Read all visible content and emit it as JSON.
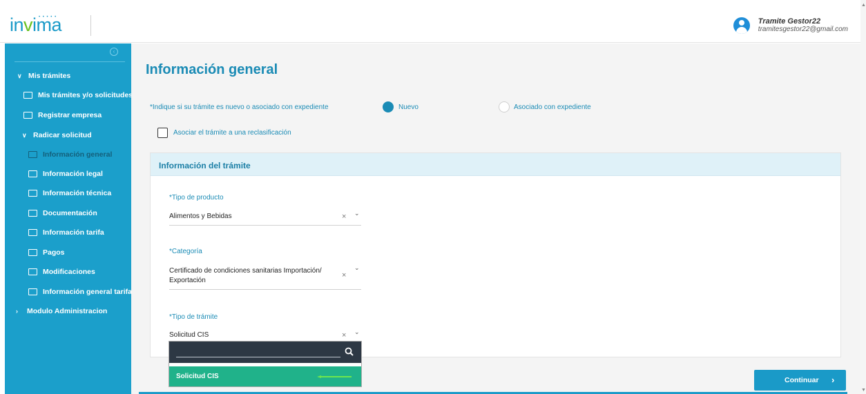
{
  "header": {
    "logo_text": "invima",
    "user_name": "Tramite Gestor22",
    "user_email": "tramitesgestor22@gmail.com"
  },
  "sidebar": {
    "collapse_icon": "collapse-circle-icon",
    "items": [
      {
        "label": "Mis trámites",
        "icon": "chevron-down-icon"
      },
      {
        "label": "Mis trámites y/o solicitudes",
        "icon": "folder-icon"
      },
      {
        "label": "Registrar empresa",
        "icon": "folder-icon"
      },
      {
        "label": "Radicar solicitud",
        "icon": "chevron-down-icon"
      },
      {
        "label": "Información general",
        "icon": "folder-icon",
        "active": true
      },
      {
        "label": "Información legal",
        "icon": "folder-icon"
      },
      {
        "label": "Información técnica",
        "icon": "folder-icon"
      },
      {
        "label": "Documentación",
        "icon": "folder-icon"
      },
      {
        "label": "Información tarifa",
        "icon": "folder-icon"
      },
      {
        "label": "Pagos",
        "icon": "folder-icon"
      },
      {
        "label": "Modificaciones",
        "icon": "folder-icon"
      },
      {
        "label": "Información general tarifa",
        "icon": "folder-icon"
      },
      {
        "label": "Modulo Administracion",
        "icon": "chevron-right-icon"
      }
    ]
  },
  "main": {
    "title": "Información general",
    "question": "*Indique si su trámite es nuevo o asociado con expediente",
    "radio_new": "Nuevo",
    "radio_associated": "Asociado con expediente",
    "radio_selected": "Nuevo",
    "checkbox_label": "Asociar el trámite a una reclasificación",
    "checkbox_checked": false
  },
  "card": {
    "title": "Información del trámite",
    "product_type_label": "*Tipo de producto",
    "product_type_value": "Alimentos y Bebidas",
    "category_label": "*Categoría",
    "category_value_line1": "Certificado de condiciones sanitarias Importación/",
    "category_value_line2": "Exportación",
    "procedure_type_label": "*Tipo de trámite",
    "procedure_type_value": "Solicitud CIS",
    "clear_glyph": "×",
    "chevron_glyph": "⌄"
  },
  "dropdown": {
    "search_value": "",
    "options": [
      {
        "label": "Solicitud CIS",
        "highlighted": true
      }
    ]
  },
  "actions": {
    "continue_label": "Continuar",
    "continue_chevron": "›"
  },
  "colors": {
    "brand": "#1a9ac8",
    "sidebar": "#1b9fcb",
    "highlight_option": "#20b28a",
    "arrow": "#6ee64e"
  }
}
